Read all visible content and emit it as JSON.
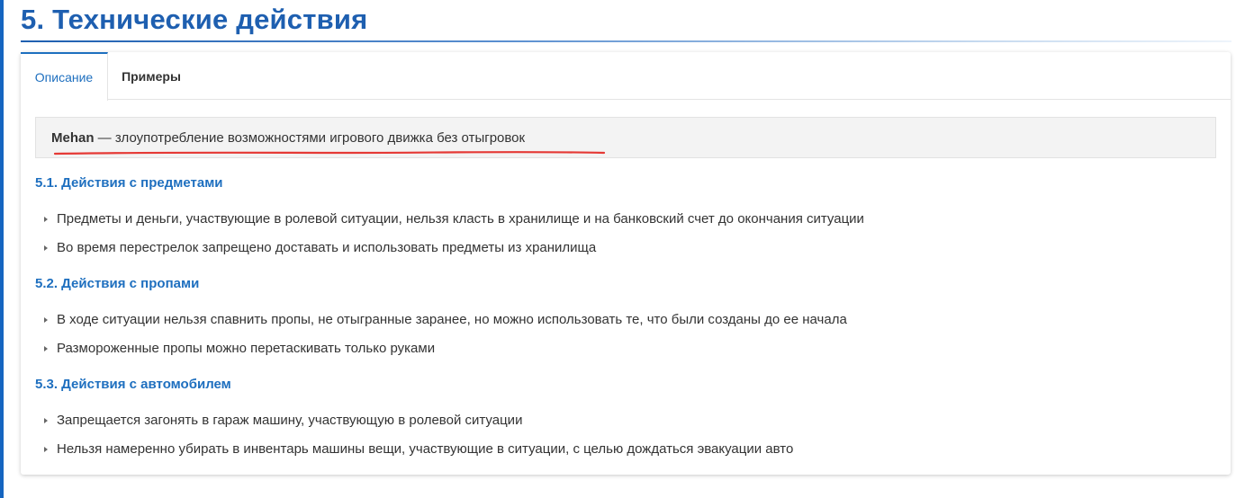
{
  "page": {
    "title": "5. Технические действия",
    "accent_color": "#1e5fb0"
  },
  "tabs": [
    {
      "label": "Описание",
      "active": true
    },
    {
      "label": "Примеры",
      "active": false
    }
  ],
  "definition": {
    "term": "Mehan",
    "text": " — злоупотребление возможностями игрового движка без отыгровок",
    "underline_color": "#e53935"
  },
  "sections": [
    {
      "heading": "5.1. Действия с предметами",
      "items": [
        "Предметы и деньги, участвующие в ролевой ситуации, нельзя класть в хранилище и на банковский счет до окончания ситуации",
        "Во время перестрелок запрещено доставать и использовать предметы из хранилища"
      ]
    },
    {
      "heading": "5.2. Действия с пропами",
      "items": [
        "В ходе ситуации нельзя спавнить пропы, не отыгранные заранее, но можно использовать те, что были созданы до ее начала",
        "Размороженные пропы можно перетаскивать только руками"
      ]
    },
    {
      "heading": "5.3. Действия с автомобилем",
      "items": [
        "Запрещается загонять в гараж машину, участвующую в ролевой ситуации",
        "Нельзя намеренно убирать в инвентарь машины вещи, участвующие в ситуации, с целью дождаться эвакуации авто"
      ]
    }
  ]
}
